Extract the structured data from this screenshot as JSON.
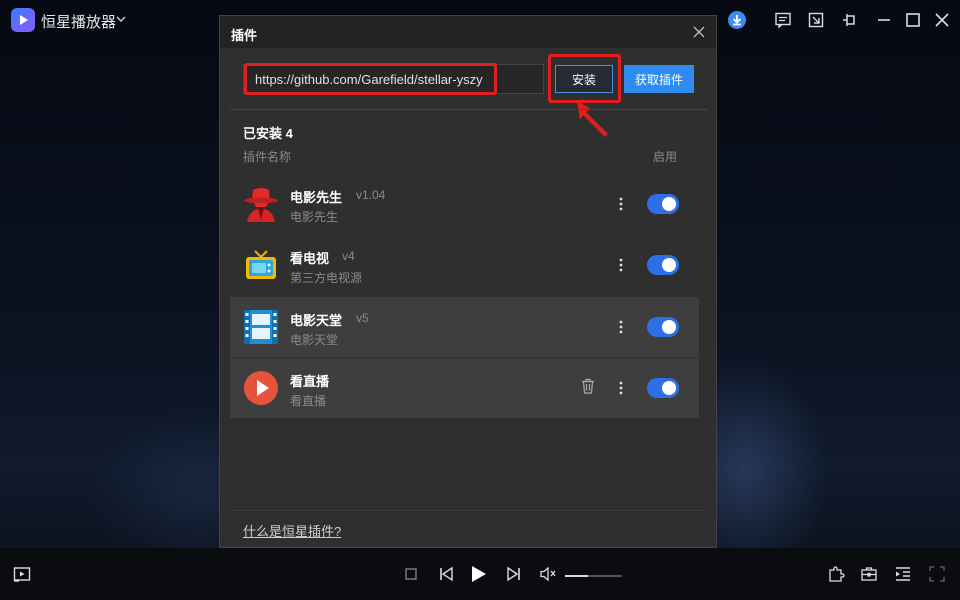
{
  "app": {
    "name": "恒星播放器"
  },
  "colors": {
    "accent": "#2e8bf0",
    "highlight": "#e0201e",
    "toggle_on": "#2e6fe8"
  },
  "titlebar_icons": [
    "download-icon",
    "message-icon",
    "screenshot-icon",
    "pin-icon",
    "minimize-icon",
    "maximize-icon",
    "close-icon"
  ],
  "dialog": {
    "title": "插件",
    "url_input": {
      "value": "https://github.com/Garefield/stellar-yszy",
      "placeholder": ""
    },
    "install_label": "安装",
    "get_plugins_label": "获取插件",
    "installed_label": "已安装 4",
    "col_name": "插件名称",
    "col_enable": "启用",
    "plugins": [
      {
        "name": "电影先生",
        "version": "v1.04",
        "desc": "电影先生",
        "icon": "spy-hat-icon",
        "enabled": true
      },
      {
        "name": "看电视",
        "version": "v4",
        "desc": "第三方电视源",
        "icon": "tv-icon",
        "enabled": true
      },
      {
        "name": "电影天堂",
        "version": "v5",
        "desc": "电影天堂",
        "icon": "film-paradise-icon",
        "enabled": true
      },
      {
        "name": "看直播",
        "version": "",
        "desc": "看直播",
        "icon": "play-circle-icon",
        "enabled": true
      }
    ],
    "help_link": "什么是恒星插件?"
  },
  "player": {
    "volume_fraction": 0.4
  }
}
